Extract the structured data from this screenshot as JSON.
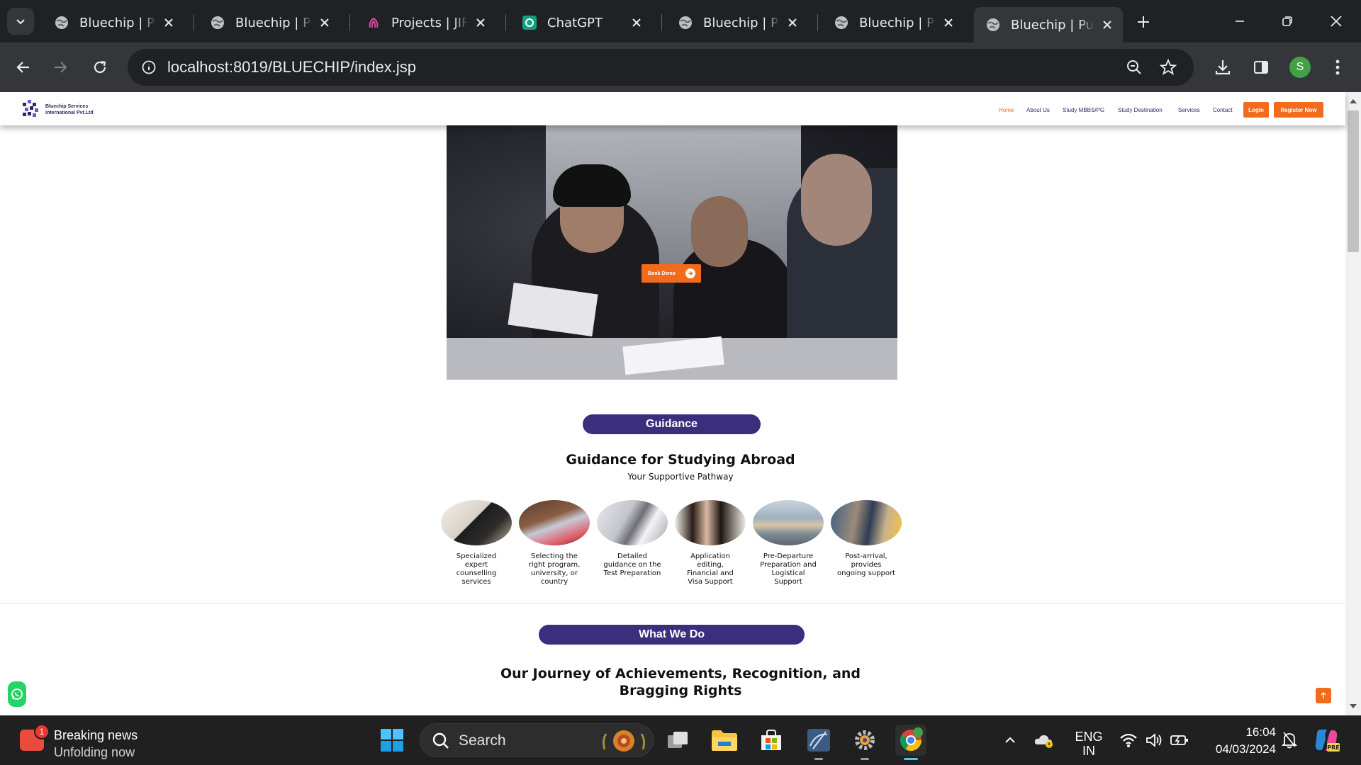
{
  "browser": {
    "tabs": [
      {
        "title": "Bluechip | Pursue",
        "icon": "globe-icon"
      },
      {
        "title": "Bluechip | Pursue",
        "icon": "globe-icon"
      },
      {
        "title": "Projects | JIFFY",
        "icon": "fingerprint-icon"
      },
      {
        "title": "ChatGPT",
        "icon": "chatgpt-icon"
      },
      {
        "title": "Bluechip | Pursue",
        "icon": "globe-icon"
      },
      {
        "title": "Bluechip | Pursue",
        "icon": "globe-icon"
      },
      {
        "title": "Bluechip | Pursue",
        "icon": "globe-icon",
        "active": true
      }
    ],
    "url": "localhost:8019/BLUECHIP/index.jsp",
    "profile_initial": "S"
  },
  "site": {
    "logo_text_1": "Bluechip Services",
    "logo_text_2": "International Pvt.Ltd",
    "nav": {
      "home": "Home",
      "about": "About Us",
      "study": "Study MBBS/PG",
      "destination": "Study Destination",
      "services": "Services",
      "contact": "Contact",
      "login": "Login",
      "register": "Register Now"
    },
    "hero": {
      "cta": "Book Demo"
    },
    "guidance": {
      "pill": "Guidance",
      "title": "Guidance for Studying Abroad",
      "subtitle": "Your Supportive Pathway",
      "items": [
        "Specialized expert counselling services",
        "Selecting the right program, university, or country",
        "Detailed guidance on the Test Preparation",
        "Application editing, Financial and Visa Support",
        "Pre-Departure Preparation and Logistical Support",
        "Post-arrival, provides ongoing support"
      ]
    },
    "what_we_do": {
      "pill": "What We Do",
      "title_line_1": "Our Journey of Achievements, Recognition, and",
      "title_line_2": "Bragging Rights"
    }
  },
  "taskbar": {
    "news_title": "Breaking news",
    "news_sub": "Unfolding now",
    "news_badge": "1",
    "search_label": "Search",
    "lang_1": "ENG",
    "lang_2": "IN",
    "time": "16:04",
    "date": "04/03/2024"
  },
  "colors": {
    "accent": "#f26b1d",
    "brand": "#3b2f7d",
    "chrome_bg": "#202124"
  }
}
